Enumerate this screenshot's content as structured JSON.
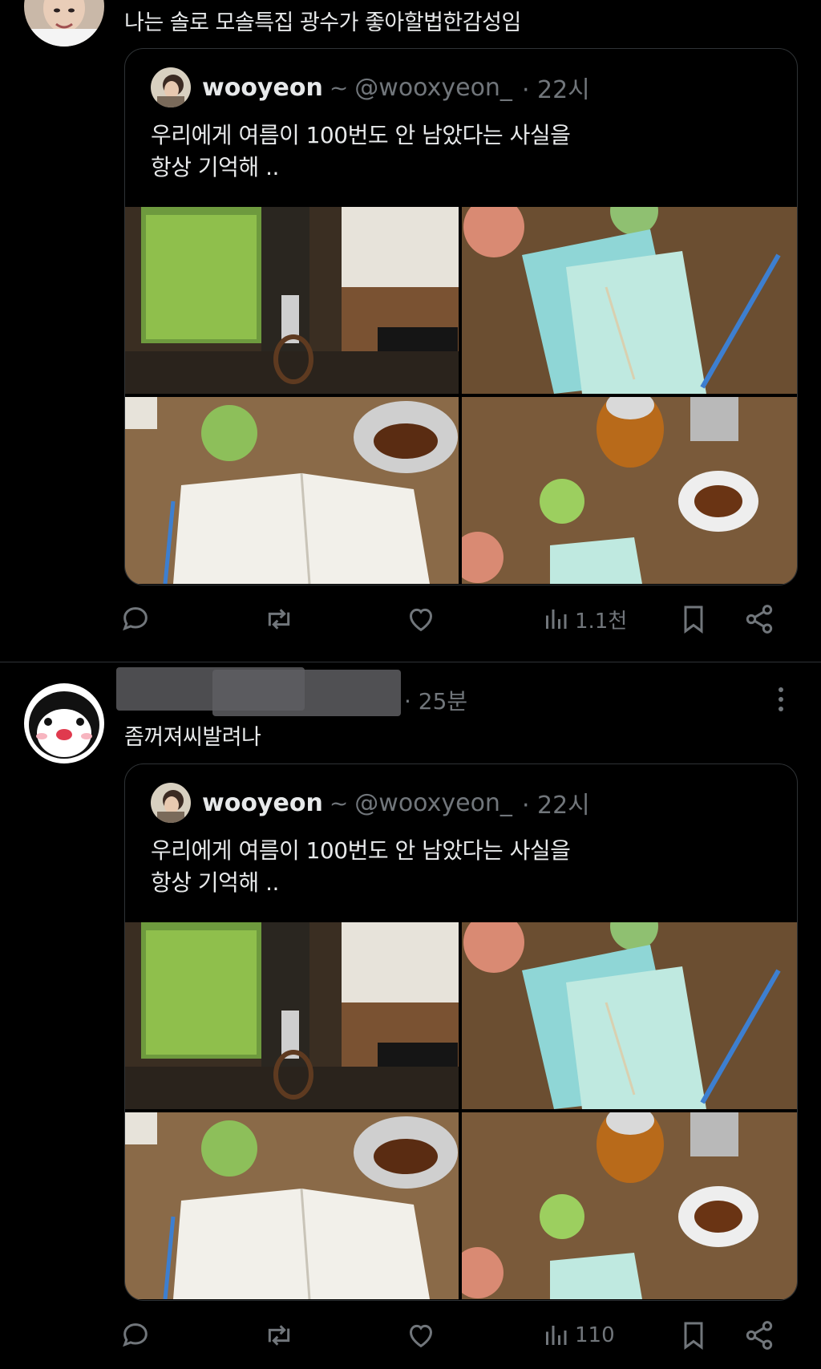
{
  "posts": [
    {
      "text": "나는 솔로 모솔특집 광수가 좋아할법한감성임",
      "quote": {
        "name": "wooyeon",
        "tilde": "~",
        "handle": "@wooxyeon_",
        "time": "· 22시",
        "text_line1": "우리에게 여름이 100번도 안 남았다는 사실을",
        "text_line2": "항상 기억해 .."
      },
      "actions": {
        "reply_icon": "reply-icon",
        "retweet_icon": "retweet-icon",
        "like_icon": "heart-icon",
        "views_icon": "views-icon",
        "views_count": "1.1천",
        "bookmark_icon": "bookmark-icon",
        "share_icon": "share-icon"
      }
    },
    {
      "time": "· 25분",
      "text": "좀꺼져씨발려나",
      "quote": {
        "name": "wooyeon",
        "tilde": "~",
        "handle": "@wooxyeon_",
        "time": "· 22시",
        "text_line1": "우리에게 여름이 100번도 안 남았다는 사실을",
        "text_line2": "항상 기억해 .."
      },
      "actions": {
        "reply_icon": "reply-icon",
        "retweet_icon": "retweet-icon",
        "like_icon": "heart-icon",
        "views_icon": "views-icon",
        "views_count": "110",
        "bookmark_icon": "bookmark-icon",
        "share_icon": "share-icon"
      }
    }
  ],
  "colors": {
    "background": "#000000",
    "text": "#e7e9ea",
    "muted": "#71767b",
    "border": "#2f3336"
  }
}
